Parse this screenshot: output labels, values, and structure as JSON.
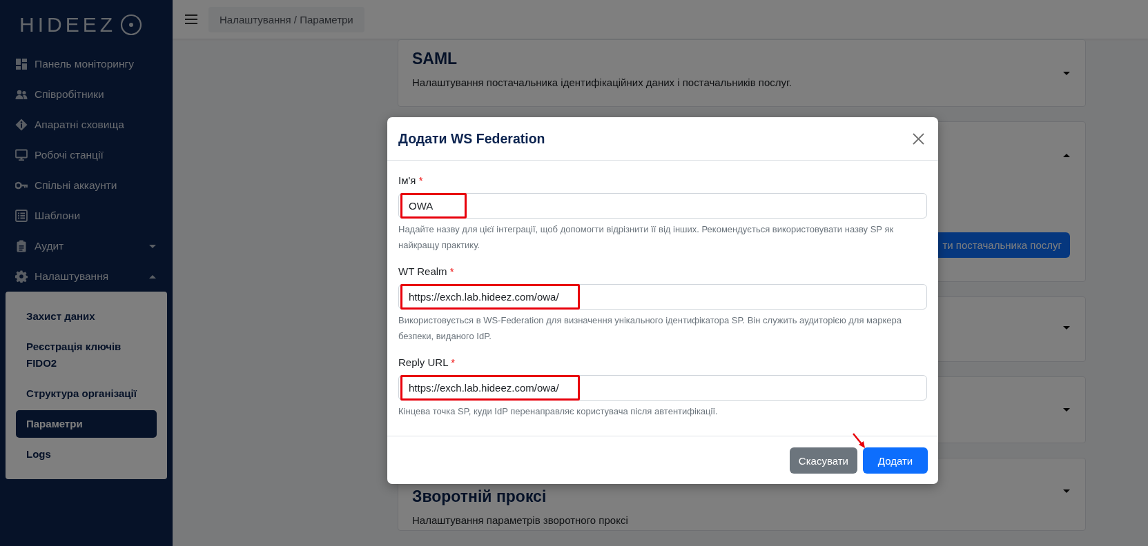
{
  "sidebar": {
    "logo": "HIDEEZ",
    "items": [
      {
        "label": "Панель моніторингу",
        "kind": "link"
      },
      {
        "label": "Співробітники",
        "kind": "link"
      },
      {
        "label": "Апаратні сховища",
        "kind": "link"
      },
      {
        "label": "Робочі станції",
        "kind": "link"
      },
      {
        "label": "Спільні аккаунти",
        "kind": "link"
      },
      {
        "label": "Шаблони",
        "kind": "link"
      },
      {
        "label": "Аудит",
        "kind": "group",
        "expanded": false
      },
      {
        "label": "Налаштування",
        "kind": "group",
        "expanded": true,
        "children": [
          {
            "label": "Захист даних",
            "selected": false
          },
          {
            "label": "Реєстрація ключів FIDO2",
            "selected": false
          },
          {
            "label": "Структура організації",
            "selected": false
          },
          {
            "label": "Параметри",
            "selected": true
          },
          {
            "label": "Logs",
            "selected": false
          }
        ]
      }
    ]
  },
  "header": {
    "breadcrumb": "Налаштування / Параметри"
  },
  "cards": [
    {
      "title": "SAML",
      "description": "Налаштування постачальника ідентифікаційних даних і постачальників послуг.",
      "expanded": false
    },
    {
      "expanded": true,
      "button": "ти постачальника послуг"
    },
    {
      "expanded": false
    },
    {
      "expanded": false
    },
    {
      "title": "Зворотній проксі",
      "description": "Налаштування параметрів зворотного проксі",
      "expanded": false
    }
  ],
  "dialog": {
    "title": "Додати WS Federation",
    "fields": [
      {
        "label": "Ім'я",
        "required_mark": "*",
        "value": "OWA",
        "highlighted": true,
        "help": "Надайте назву для цієї інтеграції, щоб допомогти відрізнити її від інших. Рекомендується використовувати назву SP як найкращу практику."
      },
      {
        "label": "WT Realm",
        "required_mark": "*",
        "value": "https://exch.lab.hideez.com/owa/",
        "highlighted": true,
        "help": "Використовується в WS-Federation для визначення унікального ідентифікатора SP. Він служить аудиторією для маркера безпеки, виданого IdP."
      },
      {
        "label": "Reply URL",
        "required_mark": "*",
        "value": "https://exch.lab.hideez.com/owa/",
        "highlighted": true,
        "help": "Кінцева точка SP, куди IdP перенаправляє користувача після автентифікації."
      }
    ],
    "buttons": [
      {
        "label": "Скасувати",
        "kind": "secondary"
      },
      {
        "label": "Додати",
        "kind": "primary"
      }
    ],
    "pointer_arrow": true
  }
}
